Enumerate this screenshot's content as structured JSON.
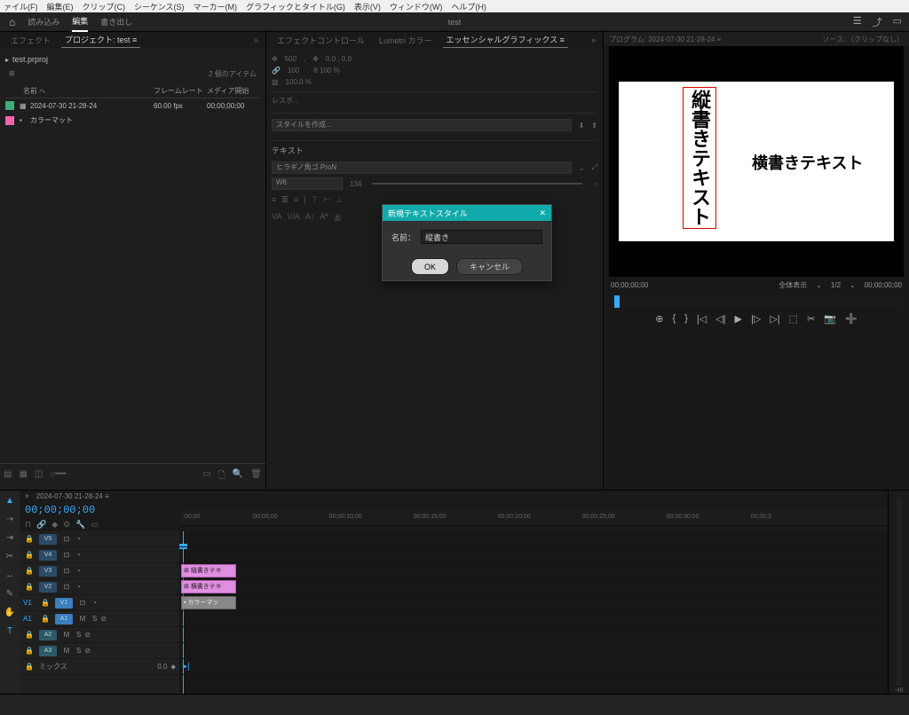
{
  "menubar": [
    "ァイル(F)",
    "編集(E)",
    "クリップ(C)",
    "シーケンス(S)",
    "マーカー(M)",
    "グラフィックとタイトル(G)",
    "表示(V)",
    "ウィンドウ(W)",
    "ヘルプ(H)"
  ],
  "toolbar": {
    "home": "⌂",
    "tabs": [
      "読み込み",
      "編集",
      "書き出し"
    ],
    "active": 1,
    "title": "test"
  },
  "project": {
    "tabs": [
      "エフェクト",
      "プロジェクト: test ≡"
    ],
    "file": "test.prproj",
    "item_count": "2 個のアイテム",
    "columns": [
      "名前",
      "フレームレート",
      "メディア開始"
    ],
    "rows": [
      {
        "color": "green",
        "name": "2024-07-30 21-28-24",
        "fps": "60.00 fps",
        "start": "00;00;00;00"
      },
      {
        "color": "pink",
        "name": "カラーマット",
        "fps": "",
        "start": ""
      }
    ]
  },
  "effect": {
    "tabs": [
      "エフェクトコントロール",
      "Lumetri カラー",
      "エッセンシャルグラフィックス ≡"
    ],
    "style_label": "スタイルを作成...",
    "text_section": "テキスト",
    "font": "ヒラギノ角ゴ ProN",
    "weight": "W6",
    "tracking": "134",
    "opacity_label": "100.0 %",
    "scale": "500"
  },
  "program": {
    "tab": "プログラム: 2024-07-30 21-28-24 ≡",
    "source": "ソース：（クリップなし）",
    "vtext": "縦書きテキスト",
    "htext": "横書きテキスト",
    "tc_left": "00;00;00;00",
    "tc_right": "00;00;00;00",
    "fit": "全体表示",
    "half": "1/2"
  },
  "timeline": {
    "seq_name": "2024-07-30 21-28-24 ≡",
    "tc": "00;00;00;00",
    "ruler": [
      ";00;00",
      ";00;05;00",
      "00;00;10;00",
      "00;00;15;00",
      "00;00;20;00",
      "00;00;25;00",
      "00;00;30;00",
      "00;00;3"
    ],
    "vtracks": [
      "V5",
      "V4",
      "V3",
      "V2",
      "V1"
    ],
    "atracks": [
      "A1",
      "A2",
      "A3"
    ],
    "mix": "ミックス",
    "mix_val": "0.0",
    "clips": {
      "v3": "縦書きテキ",
      "v2": "横書きテキ",
      "v1": "カラーマッ"
    }
  },
  "dialog": {
    "title": "新規テキストスタイル",
    "label": "名前：",
    "value": "縦書き",
    "ok": "OK",
    "cancel": "キャンセル"
  }
}
